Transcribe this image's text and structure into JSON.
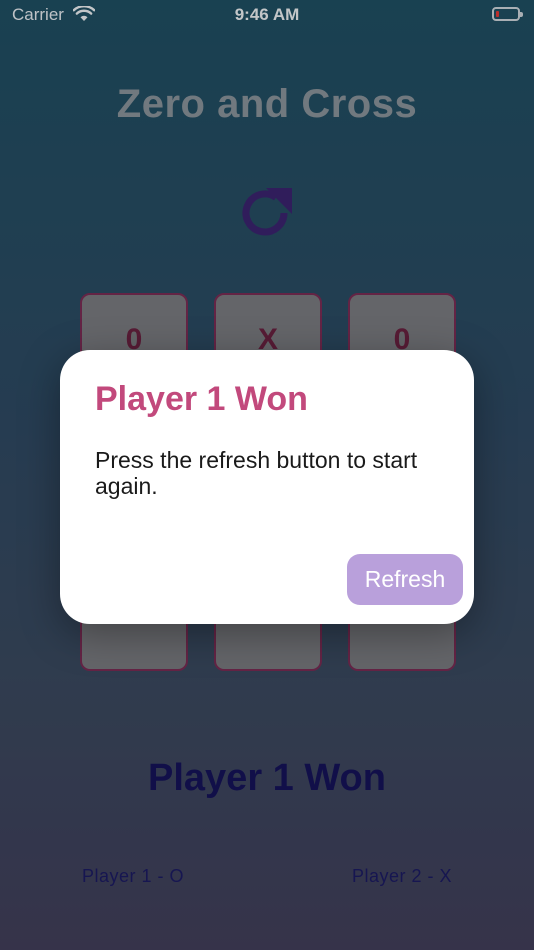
{
  "status_bar": {
    "carrier": "Carrier",
    "time": "9:46 AM"
  },
  "app": {
    "title": "Zero and Cross",
    "refresh_icon": "refresh-icon",
    "accent_color": "#3b2470"
  },
  "board": {
    "cells": [
      "0",
      "X",
      "0",
      "",
      "",
      "",
      "",
      "",
      ""
    ]
  },
  "result": {
    "winner_text": "Player 1 Won",
    "player1_label": "Player 1 - O",
    "player2_label": "Player 2 - X"
  },
  "alert": {
    "title": "Player 1 Won",
    "message": "Press the refresh button to start again.",
    "button_label": "Refresh",
    "title_color": "#c2497c",
    "button_color": "#b9a0db"
  }
}
